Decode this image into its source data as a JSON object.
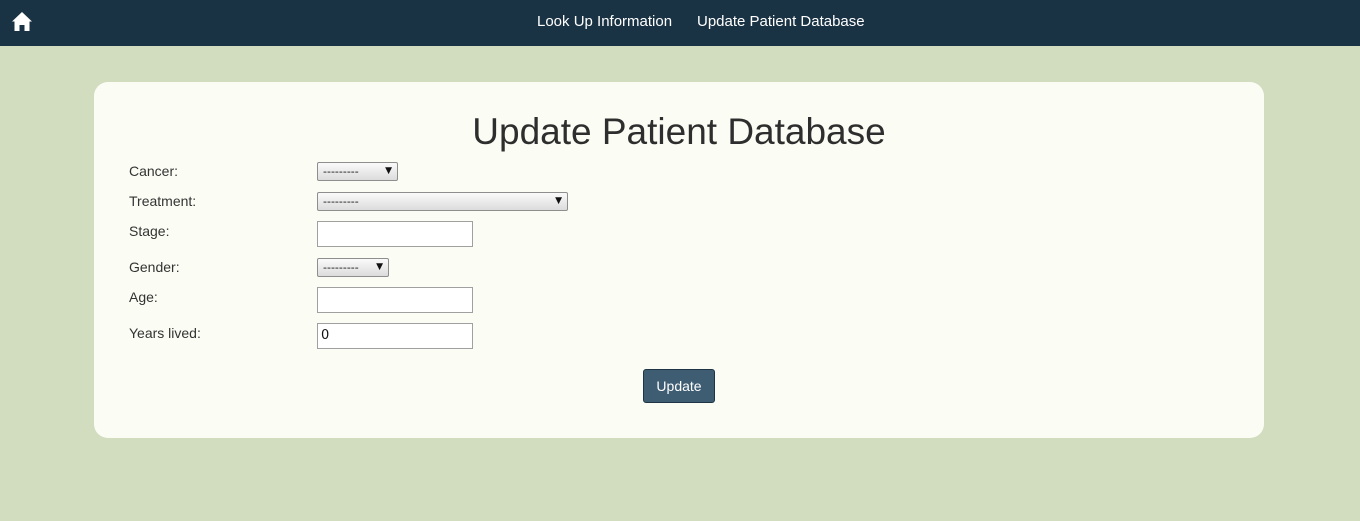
{
  "nav": {
    "home_icon": "home-icon",
    "links": [
      {
        "label": "Look Up Information"
      },
      {
        "label": "Update Patient Database"
      }
    ]
  },
  "page": {
    "title": "Update Patient Database"
  },
  "form": {
    "cancer": {
      "label": "Cancer:",
      "selected": "---------"
    },
    "treatment": {
      "label": "Treatment:",
      "selected": "---------"
    },
    "stage": {
      "label": "Stage:",
      "value": ""
    },
    "gender": {
      "label": "Gender:",
      "selected": "---------"
    },
    "age": {
      "label": "Age:",
      "value": ""
    },
    "years_lived": {
      "label": "Years lived:",
      "value": "0"
    },
    "submit_label": "Update"
  },
  "colors": {
    "navbar": "#1a3344",
    "background": "#d2dcbf",
    "card": "#fbfdf4",
    "button": "#3e5d72"
  }
}
